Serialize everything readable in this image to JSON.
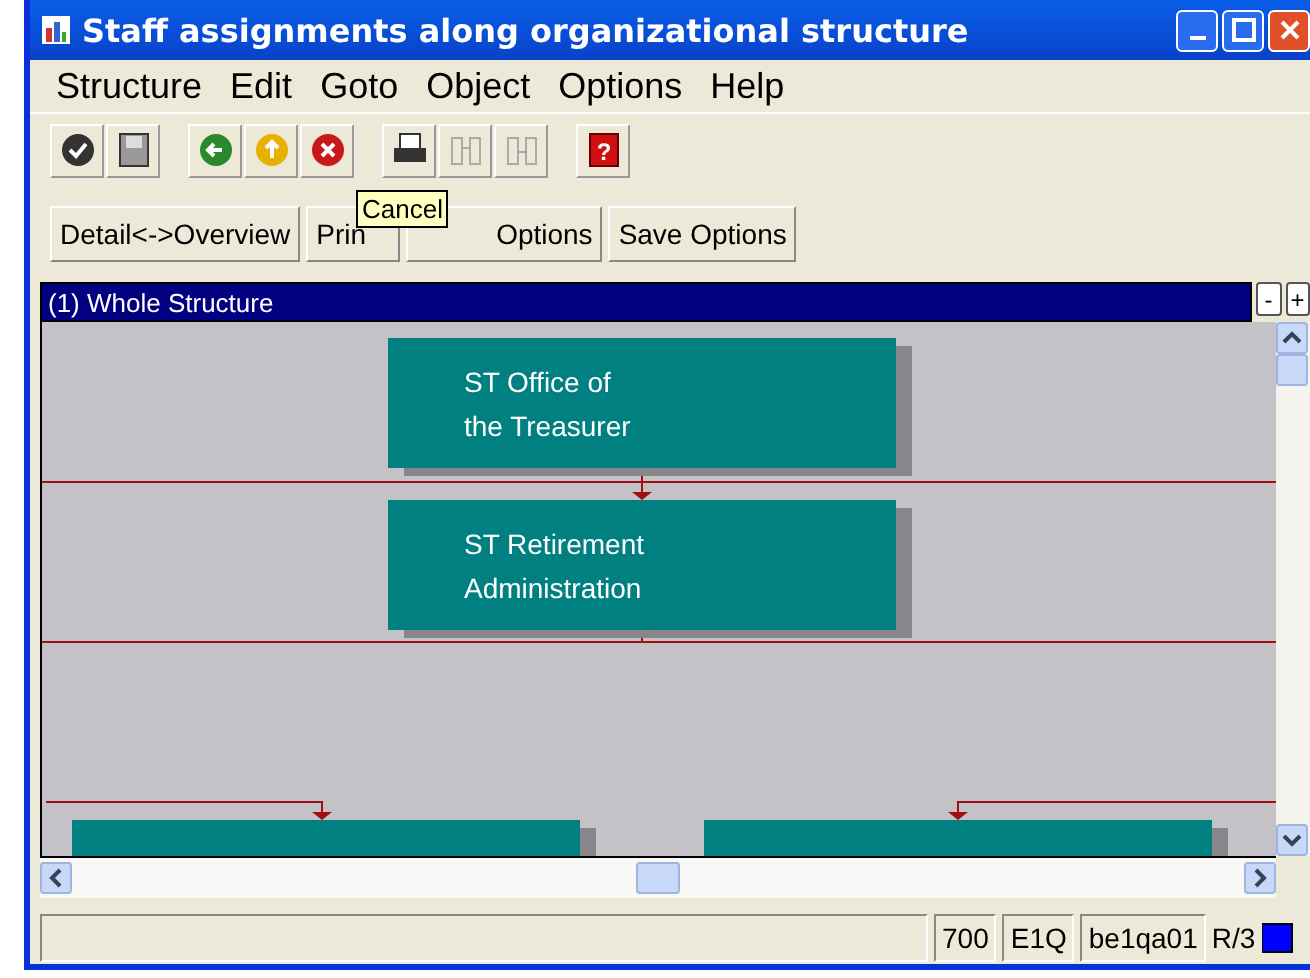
{
  "window": {
    "title": "Staff assignments along organizational structure"
  },
  "menu": [
    "Structure",
    "Edit",
    "Goto",
    "Object",
    "Options",
    "Help"
  ],
  "toolbar": [
    {
      "kind": "check",
      "disabled": false
    },
    {
      "kind": "save",
      "disabled": false
    },
    {
      "kind": "sep"
    },
    {
      "kind": "back",
      "disabled": false
    },
    {
      "kind": "up",
      "disabled": false
    },
    {
      "kind": "cancel",
      "disabled": false
    },
    {
      "kind": "sep"
    },
    {
      "kind": "print",
      "disabled": false
    },
    {
      "kind": "find",
      "disabled": true
    },
    {
      "kind": "findnext",
      "disabled": true
    },
    {
      "kind": "sep"
    },
    {
      "kind": "help",
      "disabled": false,
      "glyph": "?"
    }
  ],
  "buttons": [
    "Detail<->Overview",
    "Prin",
    "Options",
    "Save Options"
  ],
  "tooltip": "Cancel",
  "panel": {
    "title": "(1) Whole Structure",
    "controls": [
      "-",
      "+"
    ],
    "nodes": [
      {
        "lines": [
          "ST Office of",
          "the Treasurer"
        ]
      },
      {
        "lines": [
          "ST Retirement",
          "Administration"
        ]
      }
    ]
  },
  "status_bar": {
    "fields": [
      "700",
      "E1Q",
      "be1qa01"
    ],
    "system": "R/3"
  }
}
